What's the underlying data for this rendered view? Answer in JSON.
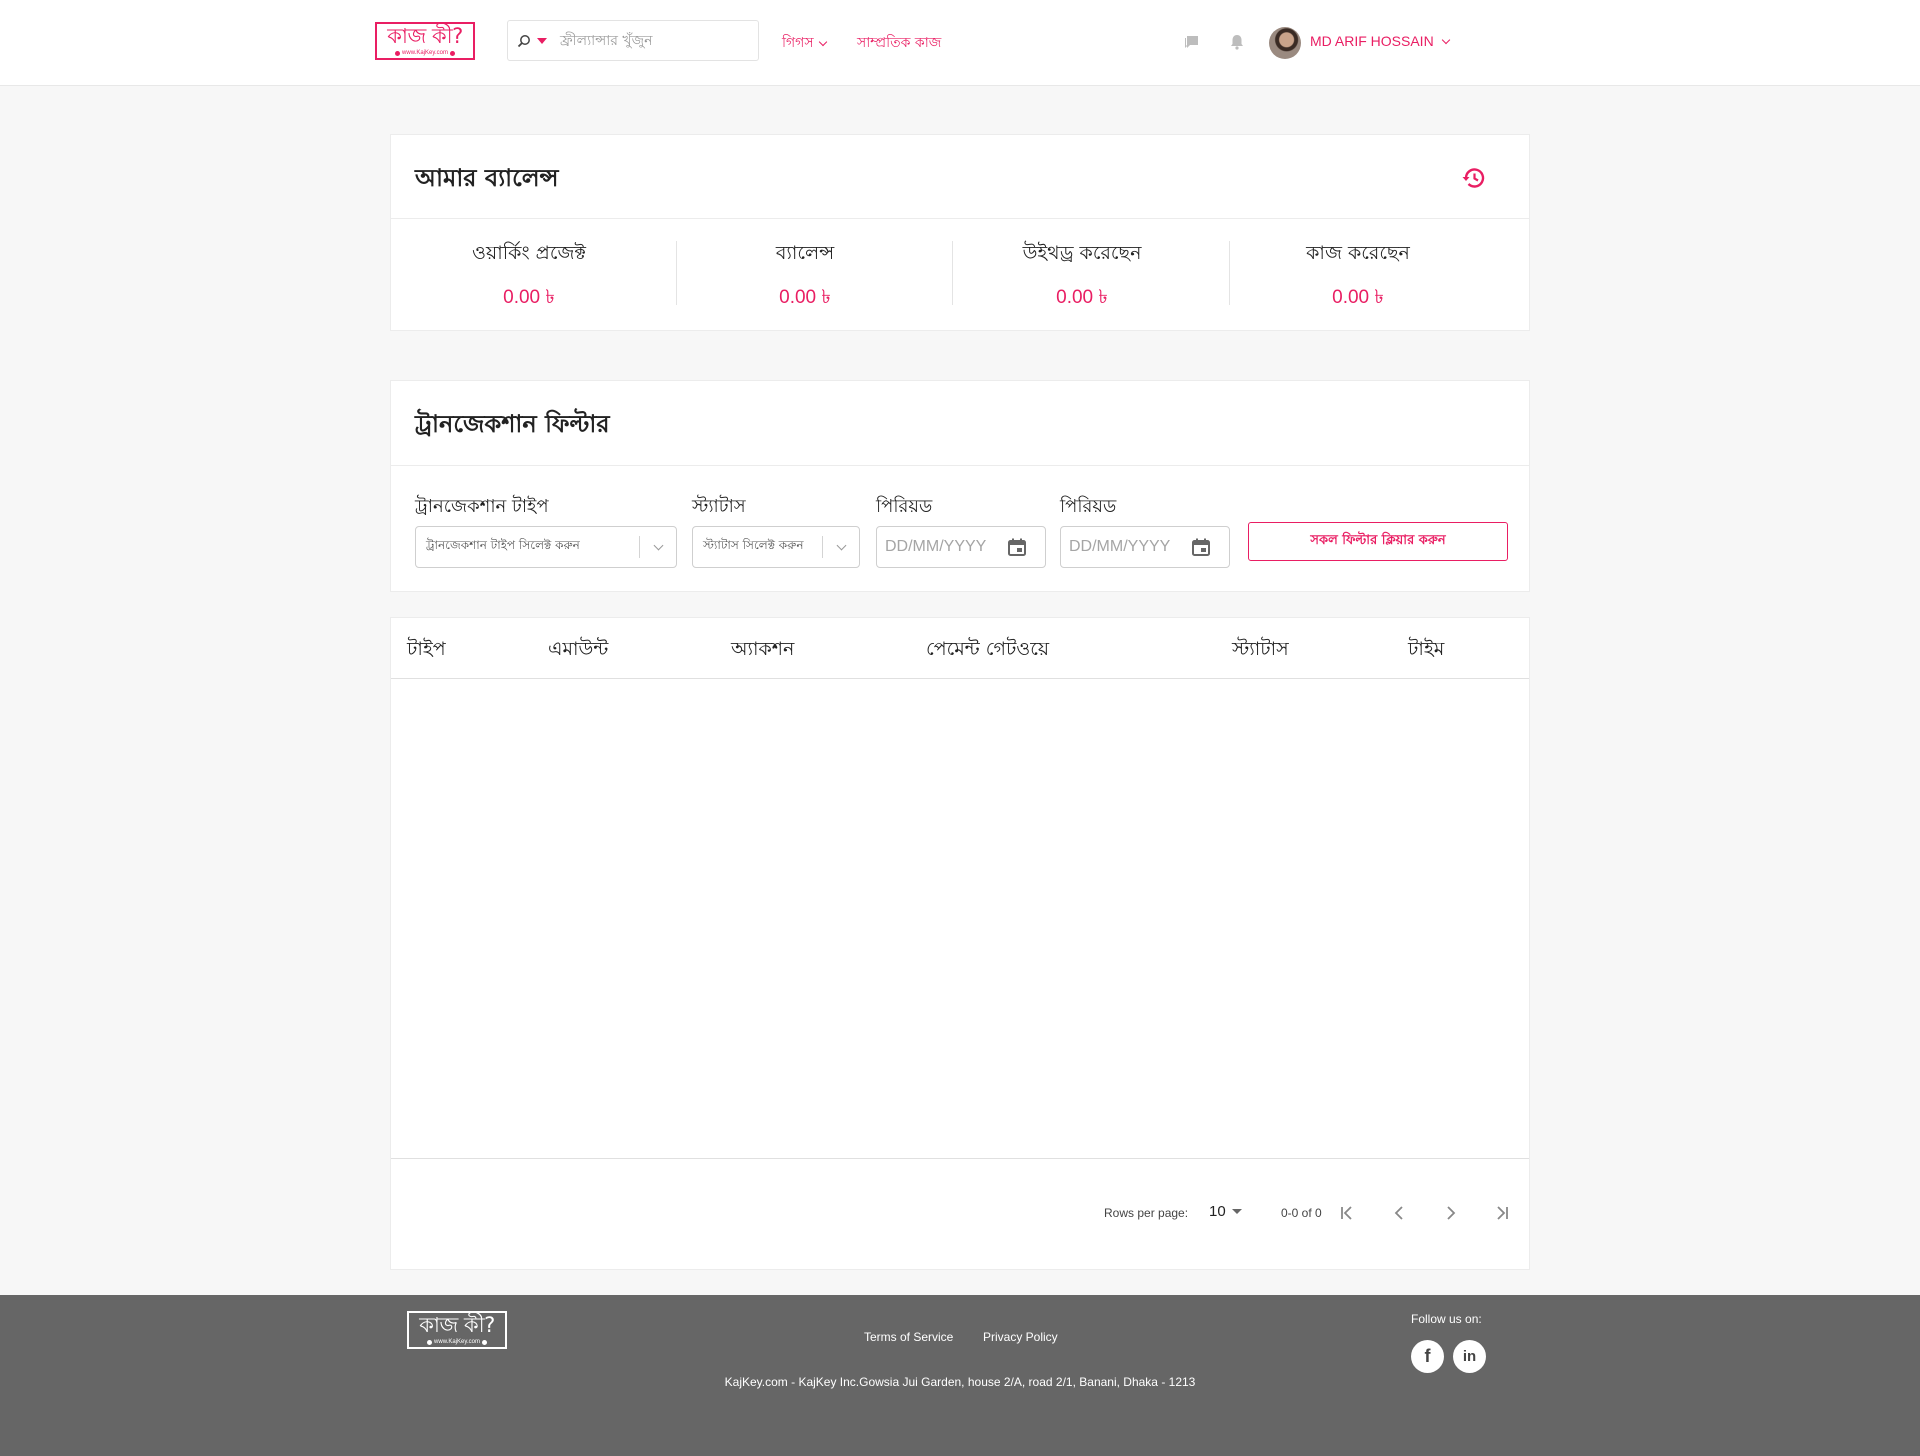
{
  "header": {
    "logo_text": "কাজ কী?",
    "logo_url": "www.KajKey.com",
    "search_placeholder": "ফ্রীল্যান্সার খুঁজুন",
    "nav": [
      {
        "label": "গিগস"
      },
      {
        "label": "সাম্প্রতিক কাজ"
      }
    ],
    "user_name": "MD ARIF HOSSAIN"
  },
  "balance": {
    "title": "আমার ব্যালেন্স",
    "stats": [
      {
        "label": "ওয়ার্কিং প্রজেক্ট",
        "value": "0.00 ৳"
      },
      {
        "label": "ব্যালেন্স",
        "value": "0.00 ৳"
      },
      {
        "label": "উইথড্র করেছেন",
        "value": "0.00 ৳"
      },
      {
        "label": "কাজ করেছেন",
        "value": "0.00 ৳"
      }
    ]
  },
  "filter": {
    "title": "ট্রানজেকশান ফিল্টার",
    "type_label": "ট্রানজেকশান টাইপ",
    "type_placeholder": "ট্রানজেকশান টাইপ সিলেক্ট করুন",
    "status_label": "স্ট্যাটাস",
    "status_placeholder": "স্ট্যাটাস সিলেক্ট করুন",
    "period_label_1": "পিরিয়ড",
    "period_label_2": "পিরিয়ড",
    "date_placeholder": "DD/MM/YYYY",
    "clear_button": "সকল ফিল্টার ক্লিয়ার করুন"
  },
  "table": {
    "columns": [
      "টাইপ",
      "এমাউন্ট",
      "অ্যাকশন",
      "পেমেন্ট গেটওয়ে",
      "স্ট্যাটাস",
      "টাইম"
    ],
    "rows_per_page_label": "Rows per page:",
    "rows_per_page": "10",
    "range": "0-0 of 0"
  },
  "footer": {
    "logo_text": "কাজ কী?",
    "logo_url": "www.KajKey.com",
    "links": [
      "Terms of Service",
      "Privacy Policy"
    ],
    "follow_label": "Follow us on:",
    "social": [
      "f",
      "in"
    ],
    "address": "KajKey.com - KajKey Inc.Gowsia Jui Garden, house 2/A, road 2/1, Banani, Dhaka - 1213"
  },
  "colors": {
    "accent": "#e91e63",
    "footer_bg": "#666666",
    "page_bg": "#f7f7f7"
  }
}
